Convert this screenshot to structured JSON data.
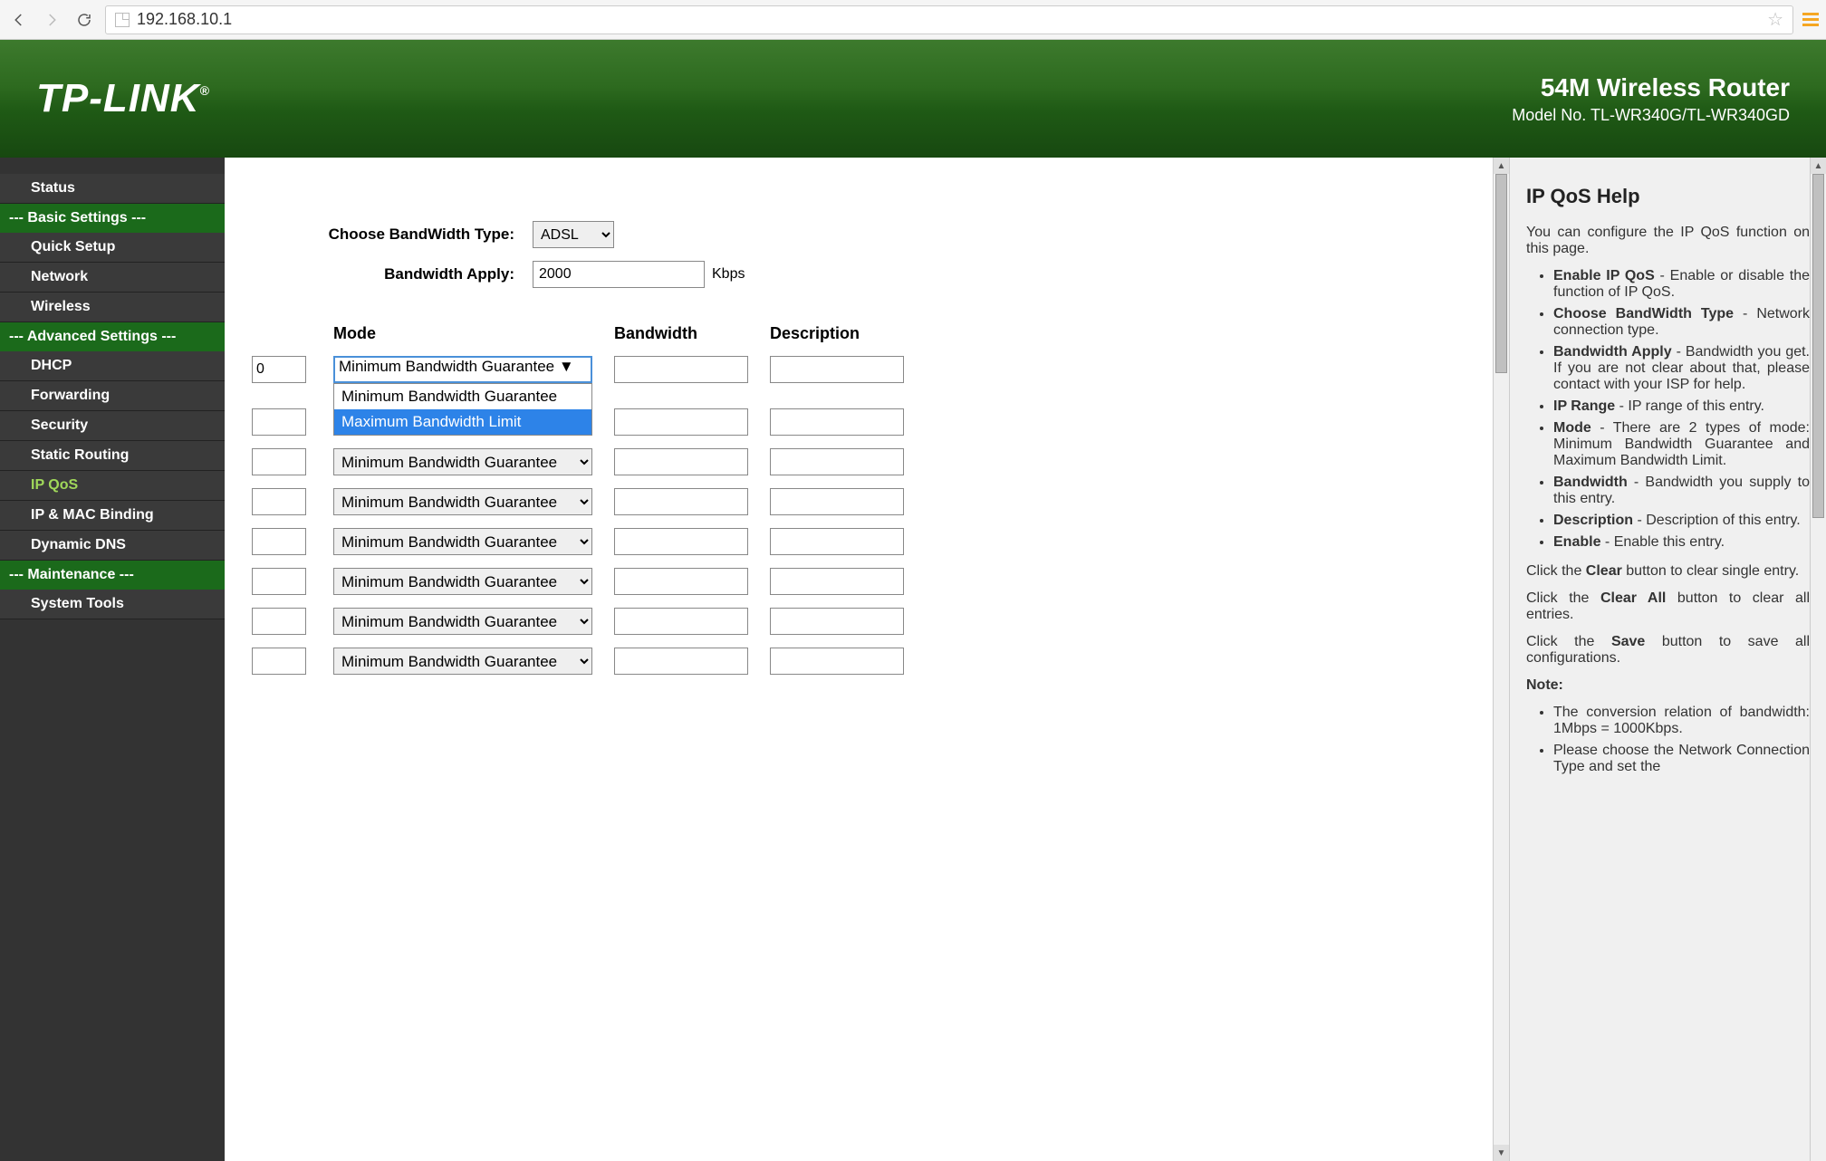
{
  "browser": {
    "url": "192.168.10.1"
  },
  "header": {
    "brand": "TP-LINK",
    "title": "54M Wireless Router",
    "model": "Model No. TL-WR340G/TL-WR340GD"
  },
  "sidebar": {
    "items": [
      {
        "label": "Status",
        "type": "item"
      },
      {
        "label": "--- Basic Settings ---",
        "type": "header"
      },
      {
        "label": "Quick Setup",
        "type": "item"
      },
      {
        "label": "Network",
        "type": "item"
      },
      {
        "label": "Wireless",
        "type": "item"
      },
      {
        "label": "--- Advanced Settings ---",
        "type": "header"
      },
      {
        "label": "DHCP",
        "type": "item"
      },
      {
        "label": "Forwarding",
        "type": "item"
      },
      {
        "label": "Security",
        "type": "item"
      },
      {
        "label": "Static Routing",
        "type": "item"
      },
      {
        "label": "IP QoS",
        "type": "item",
        "active": true
      },
      {
        "label": "IP & MAC Binding",
        "type": "item"
      },
      {
        "label": "Dynamic DNS",
        "type": "item"
      },
      {
        "label": "--- Maintenance ---",
        "type": "header"
      },
      {
        "label": "System Tools",
        "type": "item"
      }
    ]
  },
  "form": {
    "bwtype_label": "Choose BandWidth Type:",
    "bwtype_value": "ADSL",
    "bwapply_label": "Bandwidth Apply:",
    "bwapply_value": "2000",
    "bwapply_unit": "Kbps",
    "columns": {
      "mode": "Mode",
      "bandwidth": "Bandwidth",
      "description": "Description"
    },
    "mode_options": [
      "Minimum Bandwidth Guarantee",
      "Maximum Bandwidth Limit"
    ],
    "rows": [
      {
        "ip": "0",
        "mode": "Minimum Bandwidth Guarantee",
        "open": true
      },
      {
        "ip": "",
        "mode": "Minimum Bandwidth Guarantee"
      },
      {
        "ip": "",
        "mode": "Minimum Bandwidth Guarantee"
      },
      {
        "ip": "",
        "mode": "Minimum Bandwidth Guarantee"
      },
      {
        "ip": "",
        "mode": "Minimum Bandwidth Guarantee"
      },
      {
        "ip": "",
        "mode": "Minimum Bandwidth Guarantee"
      },
      {
        "ip": "",
        "mode": "Minimum Bandwidth Guarantee"
      },
      {
        "ip": "",
        "mode": "Minimum Bandwidth Guarantee"
      }
    ]
  },
  "help": {
    "title": "IP QoS Help",
    "intro": "You can configure the IP QoS function on this page.",
    "bullets": [
      {
        "b": "Enable IP QoS",
        "t": " - Enable or disable the function of IP QoS."
      },
      {
        "b": "Choose BandWidth Type",
        "t": " - Network connection type."
      },
      {
        "b": "Bandwidth Apply",
        "t": " - Bandwidth you get. If you are not clear about that, please contact with your ISP for help."
      },
      {
        "b": "IP Range",
        "t": " - IP range of this entry."
      },
      {
        "b": "Mode",
        "t": " - There are 2 types of mode: Minimum Bandwidth Guarantee and Maximum Bandwidth Limit."
      },
      {
        "b": "Bandwidth",
        "t": " - Bandwidth you supply to this entry."
      },
      {
        "b": "Description",
        "t": " - Description of this entry."
      },
      {
        "b": "Enable",
        "t": " - Enable this entry."
      }
    ],
    "p_clear_pre": "Click the ",
    "p_clear_b": "Clear",
    "p_clear_post": " button to clear single entry.",
    "p_clearall_pre": "Click the ",
    "p_clearall_b": "Clear All",
    "p_clearall_post": " button to clear all entries.",
    "p_save_pre": "Click the ",
    "p_save_b": "Save",
    "p_save_post": " button to save all configurations.",
    "note_label": "Note:",
    "notes": [
      "The conversion relation of bandwidth: 1Mbps = 1000Kbps.",
      "Please choose the Network Connection Type and set the"
    ]
  }
}
